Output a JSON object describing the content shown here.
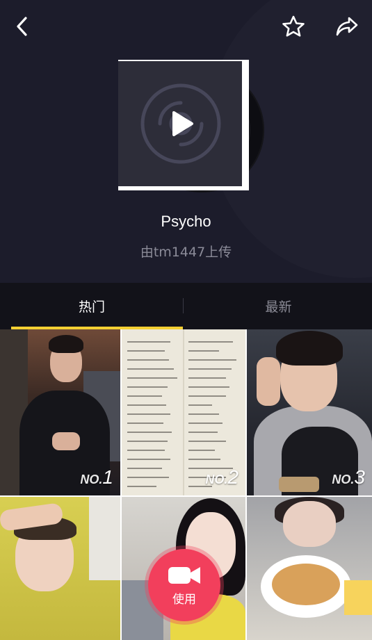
{
  "header": {
    "song_title": "Psycho",
    "uploader": "由tm1447上传"
  },
  "icons": {
    "back": "chevron-left-icon",
    "favorite": "star-outline-icon",
    "share": "share-arrow-icon",
    "play": "play-icon",
    "record": "video-camera-icon"
  },
  "tabs": [
    {
      "label": "热门",
      "selected": true
    },
    {
      "label": "最新",
      "selected": false
    }
  ],
  "videos": [
    {
      "rank_prefix": "NO.",
      "rank": "1"
    },
    {
      "rank_prefix": "NO.",
      "rank": "2"
    },
    {
      "rank_prefix": "NO.",
      "rank": "3"
    }
  ],
  "use_button": {
    "label": "使用"
  },
  "colors": {
    "tab_indicator": "#f5d033",
    "use_button": "#f23f5c",
    "header_bg": "#1c1c2b"
  }
}
